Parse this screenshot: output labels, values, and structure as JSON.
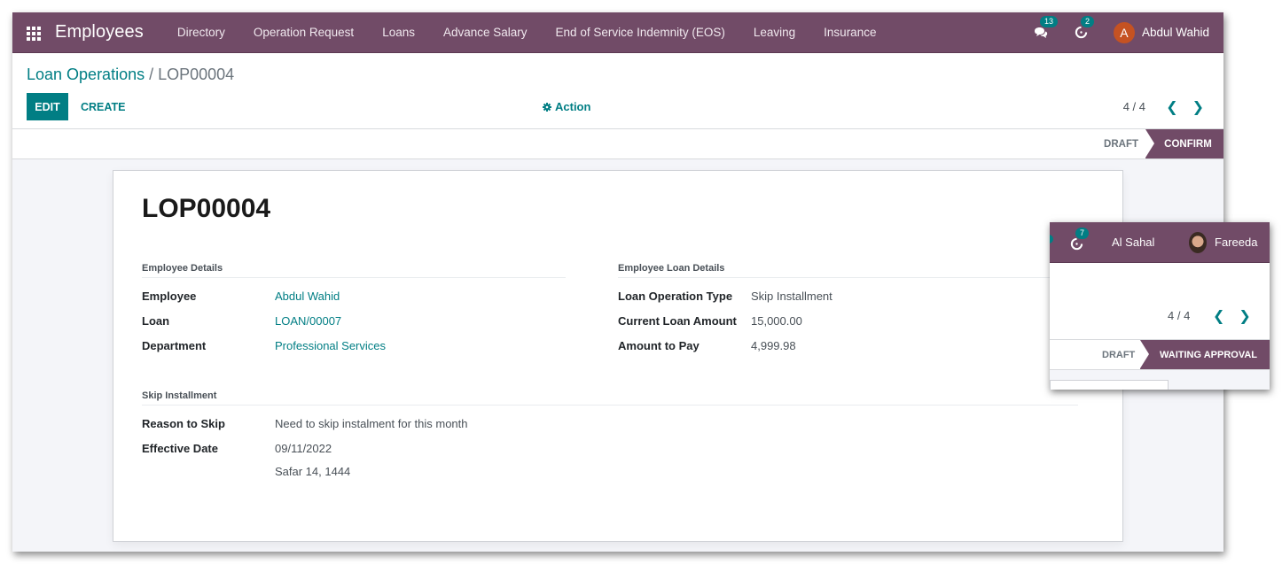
{
  "navbar": {
    "app_title": "Employees",
    "menu": [
      "Directory",
      "Operation Request",
      "Loans",
      "Advance Salary",
      "End of Service Indemnity (EOS)",
      "Leaving",
      "Insurance"
    ],
    "messages_count": "13",
    "activities_count": "2",
    "user_initial": "A",
    "user_name": "Abdul Wahid",
    "brand_color": "#714b67",
    "accent_color": "#017e84"
  },
  "breadcrumb": {
    "parent": "Loan Operations",
    "separator": " / ",
    "current": "LOP00004"
  },
  "toolbar": {
    "edit_label": "EDIT",
    "create_label": "CREATE",
    "action_label": "Action"
  },
  "pager": {
    "value": "4 / 4"
  },
  "statusbar": {
    "states": [
      "DRAFT",
      "CONFIRM"
    ],
    "active": "CONFIRM"
  },
  "record": {
    "title": "LOP00004",
    "employee_details": {
      "title": "Employee Details",
      "fields": [
        {
          "label": "Employee",
          "value": "Abdul Wahid"
        },
        {
          "label": "Loan",
          "value": "LOAN/00007"
        },
        {
          "label": "Department",
          "value": "Professional Services"
        }
      ]
    },
    "loan_details": {
      "title": "Employee Loan Details",
      "fields": [
        {
          "label": "Loan Operation Type",
          "value": "Skip Installment"
        },
        {
          "label": "Current Loan Amount",
          "value": "15,000.00"
        },
        {
          "label": "Amount to Pay",
          "value": "4,999.98"
        }
      ]
    },
    "skip_installment": {
      "title": "Skip Installment",
      "fields": [
        {
          "label": "Reason to Skip",
          "value": "Need to skip instalment for this month"
        },
        {
          "label": "Effective Date",
          "value": "09/11/2022",
          "value_secondary": "Safar 14, 1444"
        }
      ]
    }
  },
  "inset": {
    "activities_count": "7",
    "company": "Al Sahal",
    "user_name": "Fareeda",
    "pager": "4 / 4",
    "states": [
      "DRAFT",
      "WAITING APPROVAL"
    ],
    "active": "WAITING APPROVAL"
  }
}
